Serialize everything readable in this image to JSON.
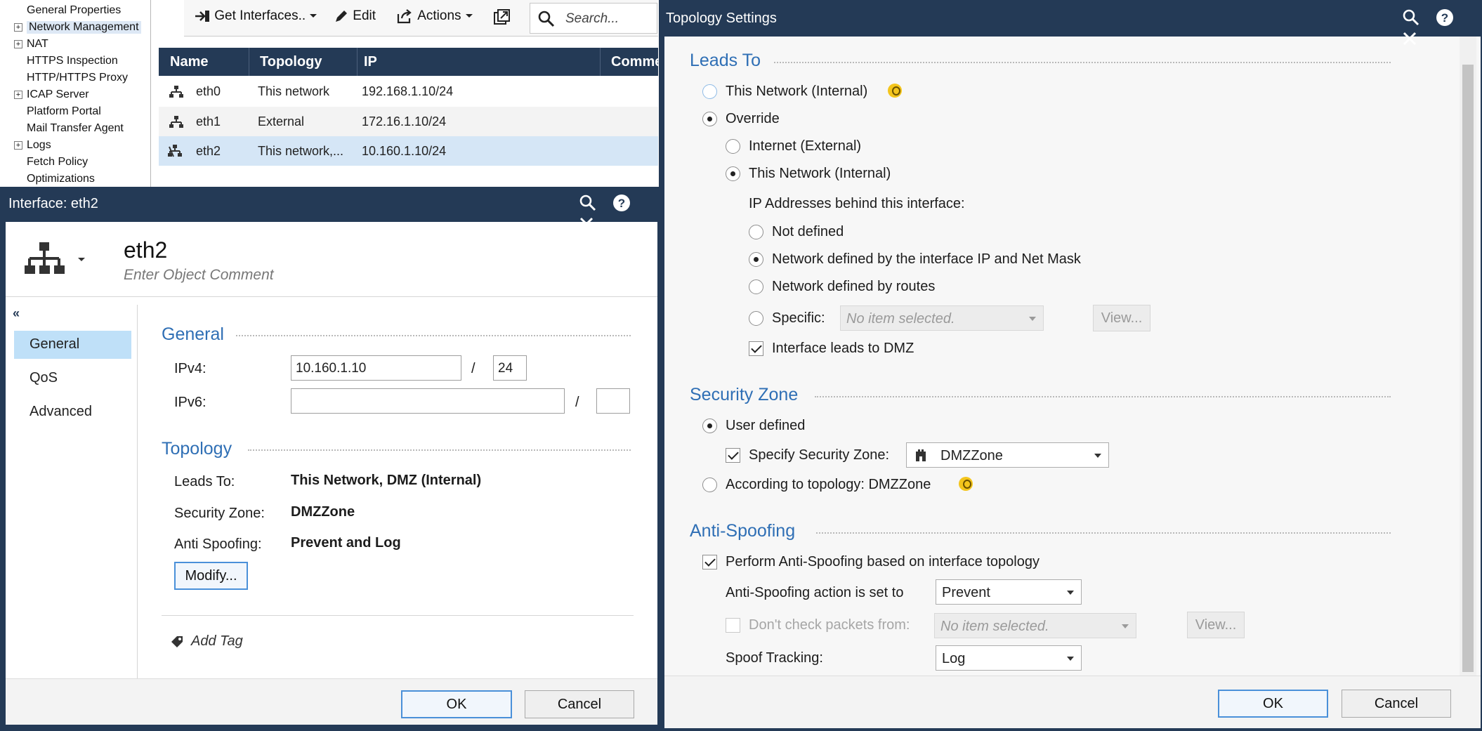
{
  "tree": {
    "items": [
      {
        "label": "General Properties",
        "expandable": false
      },
      {
        "label": "Network Management",
        "expandable": true,
        "selected": true
      },
      {
        "label": "NAT",
        "expandable": true
      },
      {
        "label": "HTTPS Inspection",
        "expandable": false
      },
      {
        "label": "HTTP/HTTPS Proxy",
        "expandable": false
      },
      {
        "label": "ICAP Server",
        "expandable": true
      },
      {
        "label": "Platform Portal",
        "expandable": false
      },
      {
        "label": "Mail Transfer Agent",
        "expandable": false
      },
      {
        "label": "Logs",
        "expandable": true
      },
      {
        "label": "Fetch Policy",
        "expandable": false
      },
      {
        "label": "Optimizations",
        "expandable": false
      }
    ],
    "expand_glyph": "+"
  },
  "toolbar": {
    "get_interfaces_label": "Get Interfaces..",
    "edit_label": "Edit",
    "actions_label": "Actions",
    "search_placeholder": "Search..."
  },
  "grid": {
    "columns": [
      "Name",
      "Topology",
      "IP",
      "Comme"
    ],
    "rows": [
      {
        "name": "eth0",
        "topology": "This network",
        "ip": "192.168.1.10/24"
      },
      {
        "name": "eth1",
        "topology": "External",
        "ip": "172.16.1.10/24"
      },
      {
        "name": "eth2",
        "topology": "This network,...",
        "ip": "10.160.1.10/24",
        "selected": true
      }
    ]
  },
  "interface_dialog": {
    "title": "Interface: eth2",
    "object_name": "eth2",
    "comment_placeholder": "Enter Object Comment",
    "collapse_glyph": "«",
    "nav": [
      "General",
      "QoS",
      "Advanced"
    ],
    "general": {
      "section": "General",
      "ipv4_label": "IPv4:",
      "ipv4_value": "10.160.1.10",
      "ipv4_mask": "24",
      "ipv6_label": "IPv6:",
      "ipv6_value": "",
      "ipv6_mask": "",
      "slash": "/"
    },
    "topology": {
      "section": "Topology",
      "leads_to_label": "Leads To:",
      "leads_to_value": "This Network, DMZ (Internal)",
      "zone_label": "Security Zone:",
      "zone_value": "DMZZone",
      "spoof_label": "Anti Spoofing:",
      "spoof_value": "Prevent and Log",
      "modify_label": "Modify..."
    },
    "add_tag_label": "Add Tag",
    "ok_label": "OK",
    "cancel_label": "Cancel"
  },
  "topology_dialog": {
    "title": "Topology Settings",
    "leads_to": {
      "section": "Leads To",
      "this_network": "This Network (Internal)",
      "override": "Override",
      "internet": "Internet (External)",
      "this_network_override": "This Network (Internal)",
      "ip_behind_label": "IP Addresses behind this interface:",
      "not_defined": "Not defined",
      "net_by_ip": "Network defined by the interface IP and Net Mask",
      "net_by_routes": "Network defined by routes",
      "specific": "Specific:",
      "specific_placeholder": "No item selected.",
      "view_label": "View...",
      "dmz_label": "Interface leads to DMZ"
    },
    "security_zone": {
      "section": "Security Zone",
      "user_defined": "User defined",
      "specify_label": "Specify Security Zone:",
      "zone_value": "DMZZone",
      "according_label": "According to topology: DMZZone"
    },
    "anti_spoofing": {
      "section": "Anti-Spoofing",
      "perform_label": "Perform Anti-Spoofing based on interface topology",
      "action_label": "Anti-Spoofing action is set to",
      "action_value": "Prevent",
      "dont_check_label": "Don't check packets from:",
      "dont_check_placeholder": "No item selected.",
      "view_label": "View...",
      "tracking_label": "Spoof Tracking:",
      "tracking_value": "Log"
    },
    "ok_label": "OK",
    "cancel_label": "Cancel"
  },
  "colors": {
    "title_bar": "#243a56",
    "section_title": "#2f6fb5",
    "selection": "#d5e6f6",
    "nav_selection": "#bfe0f8",
    "bulb": "#f4c51c"
  }
}
